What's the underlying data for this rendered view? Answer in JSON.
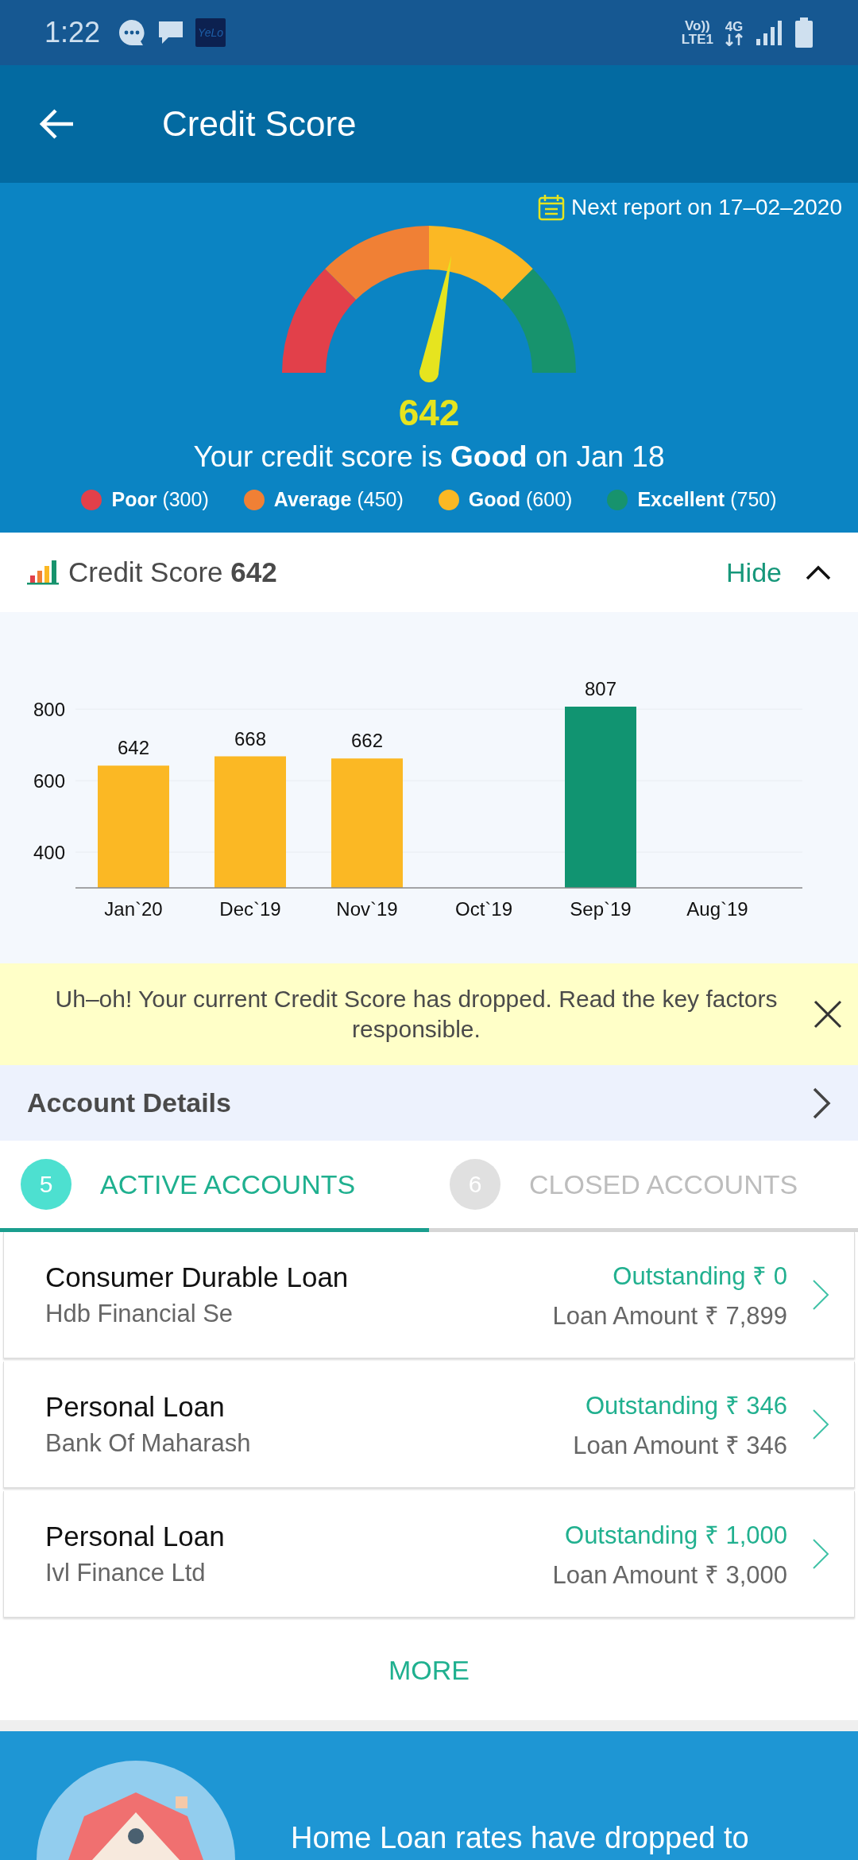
{
  "status_bar": {
    "time": "1:22",
    "app_badge": "YeLo",
    "network_top": "Vo))",
    "network_bottom": "LTE1",
    "data_type": "4G"
  },
  "app_bar": {
    "title": "Credit Score"
  },
  "score_panel": {
    "next_report": "Next report on 17–02–2020",
    "gauge": {
      "level": 0.56
    },
    "score": "642",
    "summary": "Your credit score is **Good** on Jan 18",
    "legend": [
      {
        "label": "Poor",
        "range": "(300)",
        "color": "#e2404a"
      },
      {
        "label": "Average",
        "range": "(450)",
        "color": "#f08035"
      },
      {
        "label": "Good",
        "range": "(600)",
        "color": "#fbb824"
      },
      {
        "label": "Excellent",
        "range": "(750)",
        "color": "#17936d"
      }
    ]
  },
  "history": {
    "title": "Credit Score **642**",
    "toggle": "Hide",
    "expanded": true,
    "chart_data": {
      "type": "bar",
      "categories": [
        "Jan`20",
        "Dec`19",
        "Nov`19",
        "Oct`19",
        "Sep`19",
        "Aug`19"
      ],
      "values": [
        642,
        668,
        662,
        null,
        807,
        null
      ],
      "colors": [
        "#fbb824",
        "#fbb824",
        "#fbb824",
        null,
        "#119471",
        null
      ],
      "ylim": [
        300,
        807
      ],
      "yticks": [
        400,
        600,
        800
      ],
      "grid": true,
      "data_labels": true
    }
  },
  "alert": {
    "message": "Uh–oh! Your current Credit Score has dropped. Read the key factors responsible."
  },
  "account_details": {
    "title": "Account Details"
  },
  "tabs": [
    {
      "count": "5",
      "label": "ACTIVE ACCOUNTS",
      "selected": true
    },
    {
      "count": "6",
      "label": "CLOSED ACCOUNTS",
      "selected": false
    }
  ],
  "accounts": [
    {
      "name": "Consumer Durable Loan",
      "lender": "Hdb Financial Se",
      "outstanding": "Outstanding ₹ 0",
      "loan_amount": "Loan Amount ₹ 7,899"
    },
    {
      "name": "Personal Loan",
      "lender": "Bank Of Maharash",
      "outstanding": "Outstanding ₹ 346",
      "loan_amount": "Loan Amount ₹ 346"
    },
    {
      "name": "Personal Loan",
      "lender": "Ivl Finance Ltd",
      "outstanding": "Outstanding ₹ 1,000",
      "loan_amount": "Loan Amount ₹ 3,000"
    }
  ],
  "more_button": "MORE",
  "promo": {
    "text": "Home Loan rates have dropped to"
  }
}
